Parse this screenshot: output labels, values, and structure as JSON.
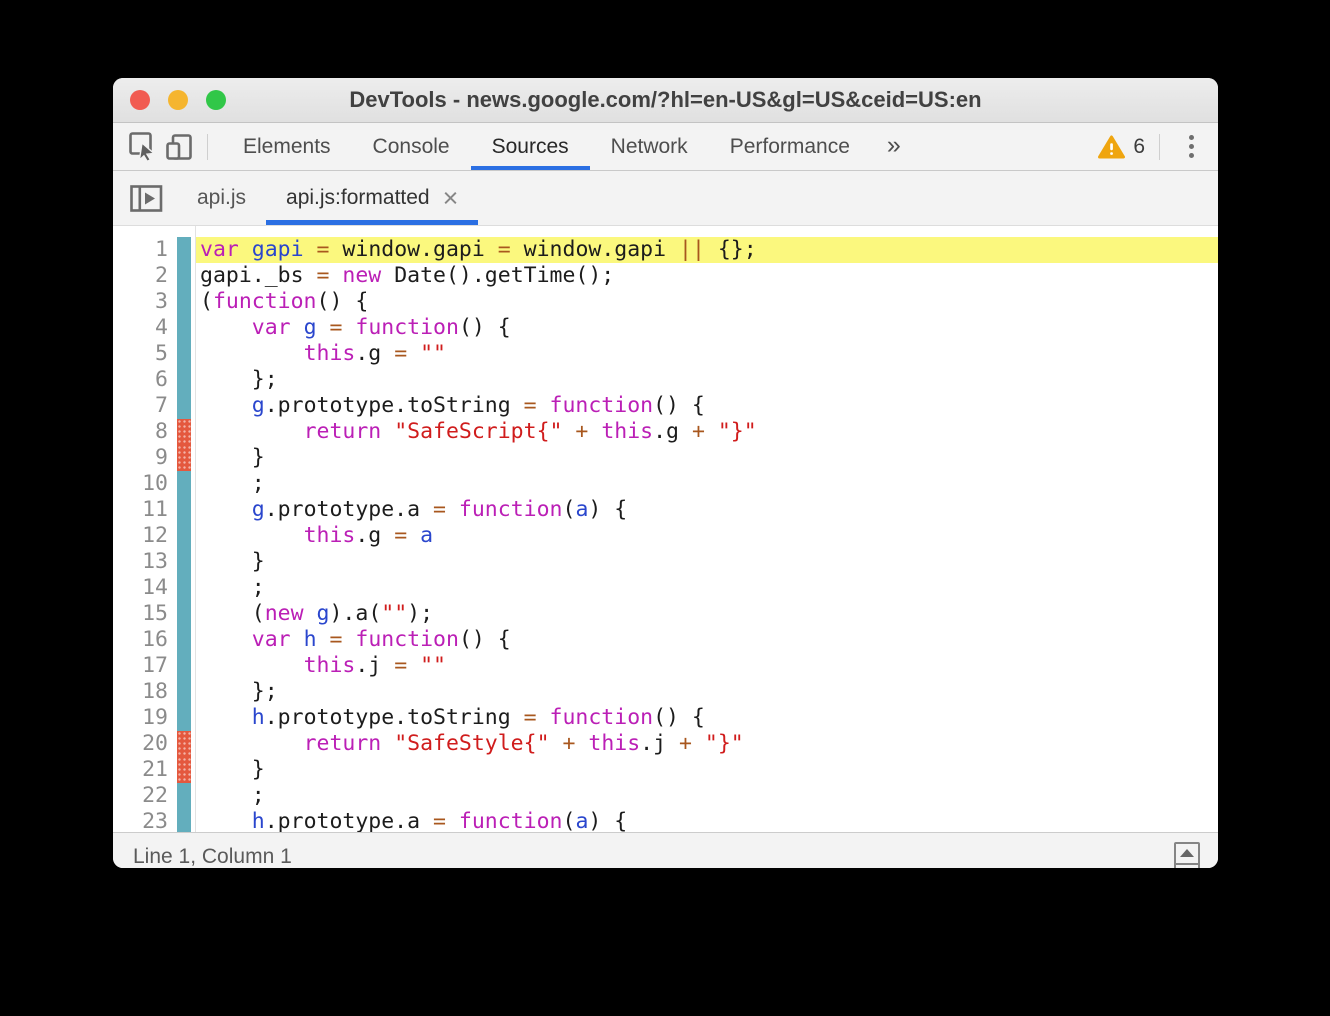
{
  "window": {
    "title": "DevTools - news.google.com/?hl=en-US&gl=US&ceid=US:en"
  },
  "titlebar_buttons": [
    "close",
    "minimize",
    "zoom"
  ],
  "toolbar": {
    "tabs": [
      {
        "label": "Elements",
        "selected": false
      },
      {
        "label": "Console",
        "selected": false
      },
      {
        "label": "Sources",
        "selected": true
      },
      {
        "label": "Network",
        "selected": false
      },
      {
        "label": "Performance",
        "selected": false
      }
    ],
    "more_label": "»",
    "warning_count": "6",
    "icons": [
      "inspect-cursor-icon",
      "device-toolbar-icon",
      "warning-triangle-icon",
      "kebab-menu-icon"
    ]
  },
  "file_tabs": [
    {
      "label": "api.js",
      "active": false
    },
    {
      "label": "api.js:formatted",
      "active": true,
      "close": "×"
    }
  ],
  "status": {
    "text": "Line 1, Column 1"
  },
  "colors": {
    "accent_blue": "#2b6fe3",
    "highlight_yellow": "#fbf87e",
    "gutter_teal": "#63aebd",
    "gutter_red": "#e4583e",
    "warning_amber": "#efa50f",
    "traffic_red": "#f15b51",
    "traffic_yellow": "#f5b52f",
    "traffic_green": "#31c748",
    "syntax": {
      "kw": "#bb1fb6",
      "def": "#2a46cd",
      "op": "#a8571e",
      "str": "#d01c1c",
      "pl": "#1c1c1c"
    }
  },
  "editor": {
    "lines": [
      {
        "n": 1,
        "m": "teal",
        "hl": true,
        "t": [
          [
            "kw",
            "var"
          ],
          [
            "pl",
            " "
          ],
          [
            "def",
            "gapi"
          ],
          [
            "pl",
            " "
          ],
          [
            "op",
            "="
          ],
          [
            "pl",
            " window.gapi "
          ],
          [
            "op",
            "="
          ],
          [
            "pl",
            " window.gapi "
          ],
          [
            "op",
            "||"
          ],
          [
            "pl",
            " {};"
          ]
        ]
      },
      {
        "n": 2,
        "m": "teal",
        "t": [
          [
            "pl",
            "gapi._bs "
          ],
          [
            "op",
            "="
          ],
          [
            "pl",
            " "
          ],
          [
            "kw",
            "new"
          ],
          [
            "pl",
            " Date().getTime();"
          ]
        ]
      },
      {
        "n": 3,
        "m": "teal",
        "t": [
          [
            "pl",
            "("
          ],
          [
            "kw",
            "function"
          ],
          [
            "pl",
            "() {"
          ]
        ]
      },
      {
        "n": 4,
        "m": "teal",
        "t": [
          [
            "pl",
            "    "
          ],
          [
            "kw",
            "var"
          ],
          [
            "pl",
            " "
          ],
          [
            "def",
            "g"
          ],
          [
            "pl",
            " "
          ],
          [
            "op",
            "="
          ],
          [
            "pl",
            " "
          ],
          [
            "kw",
            "function"
          ],
          [
            "pl",
            "() {"
          ]
        ]
      },
      {
        "n": 5,
        "m": "teal",
        "t": [
          [
            "pl",
            "        "
          ],
          [
            "kw",
            "this"
          ],
          [
            "pl",
            ".g "
          ],
          [
            "op",
            "="
          ],
          [
            "pl",
            " "
          ],
          [
            "str",
            "\"\""
          ]
        ]
      },
      {
        "n": 6,
        "m": "teal",
        "t": [
          [
            "pl",
            "    };"
          ]
        ]
      },
      {
        "n": 7,
        "m": "teal",
        "t": [
          [
            "pl",
            "    "
          ],
          [
            "def",
            "g"
          ],
          [
            "pl",
            ".prototype.toString "
          ],
          [
            "op",
            "="
          ],
          [
            "pl",
            " "
          ],
          [
            "kw",
            "function"
          ],
          [
            "pl",
            "() {"
          ]
        ]
      },
      {
        "n": 8,
        "m": "red",
        "t": [
          [
            "pl",
            "        "
          ],
          [
            "kw",
            "return"
          ],
          [
            "pl",
            " "
          ],
          [
            "str",
            "\"SafeScript{\""
          ],
          [
            "pl",
            " "
          ],
          [
            "op",
            "+"
          ],
          [
            "pl",
            " "
          ],
          [
            "kw",
            "this"
          ],
          [
            "pl",
            ".g "
          ],
          [
            "op",
            "+"
          ],
          [
            "pl",
            " "
          ],
          [
            "str",
            "\"}\""
          ]
        ]
      },
      {
        "n": 9,
        "m": "red",
        "t": [
          [
            "pl",
            "    }"
          ]
        ]
      },
      {
        "n": 10,
        "m": "teal",
        "t": [
          [
            "pl",
            "    ;"
          ]
        ]
      },
      {
        "n": 11,
        "m": "teal",
        "t": [
          [
            "pl",
            "    "
          ],
          [
            "def",
            "g"
          ],
          [
            "pl",
            ".prototype.a "
          ],
          [
            "op",
            "="
          ],
          [
            "pl",
            " "
          ],
          [
            "kw",
            "function"
          ],
          [
            "pl",
            "("
          ],
          [
            "def",
            "a"
          ],
          [
            "pl",
            ") {"
          ]
        ]
      },
      {
        "n": 12,
        "m": "teal",
        "t": [
          [
            "pl",
            "        "
          ],
          [
            "kw",
            "this"
          ],
          [
            "pl",
            ".g "
          ],
          [
            "op",
            "="
          ],
          [
            "pl",
            " "
          ],
          [
            "def",
            "a"
          ]
        ]
      },
      {
        "n": 13,
        "m": "teal",
        "t": [
          [
            "pl",
            "    }"
          ]
        ]
      },
      {
        "n": 14,
        "m": "teal",
        "t": [
          [
            "pl",
            "    ;"
          ]
        ]
      },
      {
        "n": 15,
        "m": "teal",
        "t": [
          [
            "pl",
            "    ("
          ],
          [
            "kw",
            "new"
          ],
          [
            "pl",
            " "
          ],
          [
            "def",
            "g"
          ],
          [
            "pl",
            ").a("
          ],
          [
            "str",
            "\"\""
          ],
          [
            "pl",
            ");"
          ]
        ]
      },
      {
        "n": 16,
        "m": "teal",
        "t": [
          [
            "pl",
            "    "
          ],
          [
            "kw",
            "var"
          ],
          [
            "pl",
            " "
          ],
          [
            "def",
            "h"
          ],
          [
            "pl",
            " "
          ],
          [
            "op",
            "="
          ],
          [
            "pl",
            " "
          ],
          [
            "kw",
            "function"
          ],
          [
            "pl",
            "() {"
          ]
        ]
      },
      {
        "n": 17,
        "m": "teal",
        "t": [
          [
            "pl",
            "        "
          ],
          [
            "kw",
            "this"
          ],
          [
            "pl",
            ".j "
          ],
          [
            "op",
            "="
          ],
          [
            "pl",
            " "
          ],
          [
            "str",
            "\"\""
          ]
        ]
      },
      {
        "n": 18,
        "m": "teal",
        "t": [
          [
            "pl",
            "    };"
          ]
        ]
      },
      {
        "n": 19,
        "m": "teal",
        "t": [
          [
            "pl",
            "    "
          ],
          [
            "def",
            "h"
          ],
          [
            "pl",
            ".prototype.toString "
          ],
          [
            "op",
            "="
          ],
          [
            "pl",
            " "
          ],
          [
            "kw",
            "function"
          ],
          [
            "pl",
            "() {"
          ]
        ]
      },
      {
        "n": 20,
        "m": "red",
        "t": [
          [
            "pl",
            "        "
          ],
          [
            "kw",
            "return"
          ],
          [
            "pl",
            " "
          ],
          [
            "str",
            "\"SafeStyle{\""
          ],
          [
            "pl",
            " "
          ],
          [
            "op",
            "+"
          ],
          [
            "pl",
            " "
          ],
          [
            "kw",
            "this"
          ],
          [
            "pl",
            ".j "
          ],
          [
            "op",
            "+"
          ],
          [
            "pl",
            " "
          ],
          [
            "str",
            "\"}\""
          ]
        ]
      },
      {
        "n": 21,
        "m": "red",
        "t": [
          [
            "pl",
            "    }"
          ]
        ]
      },
      {
        "n": 22,
        "m": "teal",
        "t": [
          [
            "pl",
            "    ;"
          ]
        ]
      },
      {
        "n": 23,
        "m": "teal",
        "t": [
          [
            "pl",
            "    "
          ],
          [
            "def",
            "h"
          ],
          [
            "pl",
            ".prototype.a "
          ],
          [
            "op",
            "="
          ],
          [
            "pl",
            " "
          ],
          [
            "kw",
            "function"
          ],
          [
            "pl",
            "("
          ],
          [
            "def",
            "a"
          ],
          [
            "pl",
            ") {"
          ]
        ]
      }
    ]
  }
}
